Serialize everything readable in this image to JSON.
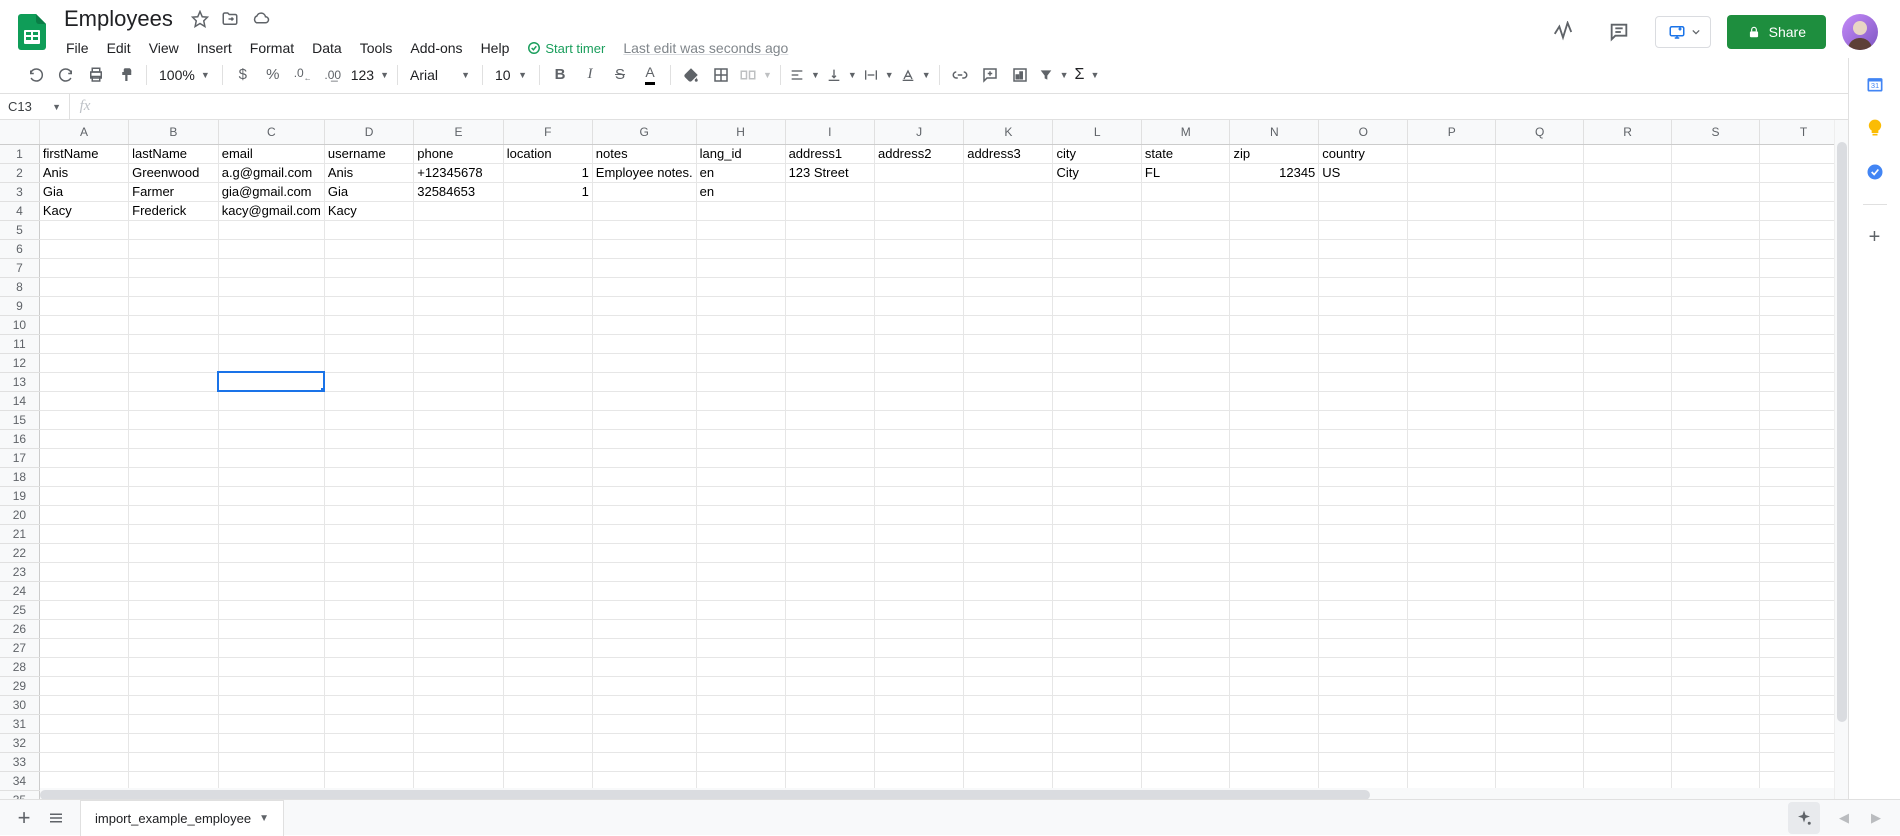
{
  "doc_title": "Employees",
  "menus": [
    "File",
    "Edit",
    "View",
    "Insert",
    "Format",
    "Data",
    "Tools",
    "Add-ons",
    "Help"
  ],
  "start_timer": "Start timer",
  "last_edit": "Last edit was seconds ago",
  "share": "Share",
  "toolbar": {
    "zoom": "100%",
    "currency": "$",
    "percent": "%",
    "dec_dec": ".0",
    "inc_dec": ".00",
    "format_more": "123",
    "font": "Arial",
    "font_size": "10"
  },
  "name_box": "C13",
  "fx": "fx",
  "columns": [
    "A",
    "B",
    "C",
    "D",
    "E",
    "F",
    "G",
    "H",
    "I",
    "J",
    "K",
    "L",
    "M",
    "N",
    "O",
    "P",
    "Q",
    "R",
    "S",
    "T"
  ],
  "row_count": 35,
  "selected_cell": {
    "row": 13,
    "col": 3
  },
  "chart_data": {
    "type": "table",
    "headers": [
      "firstName",
      "lastName",
      "email",
      "username",
      "phone",
      "location",
      "notes",
      "lang_id",
      "address1",
      "address2",
      "address3",
      "city",
      "state",
      "zip",
      "country"
    ],
    "rows": [
      {
        "firstName": "Anis",
        "lastName": "Greenwood",
        "email": "a.g@gmail.com",
        "username": "Anis",
        "phone": "+12345678",
        "location": "1",
        "notes": "Employee notes.",
        "lang_id": "en",
        "address1": "123 Street",
        "address2": "",
        "address3": "",
        "city": "City",
        "state": "FL",
        "zip": "12345",
        "country": "US"
      },
      {
        "firstName": "Gia",
        "lastName": "Farmer",
        "email": "gia@gmail.com",
        "username": "Gia",
        "phone": "32584653",
        "location": "1",
        "notes": "",
        "lang_id": "en",
        "address1": "",
        "address2": "",
        "address3": "",
        "city": "",
        "state": "",
        "zip": "",
        "country": ""
      },
      {
        "firstName": "Kacy",
        "lastName": "Frederick",
        "email": "kacy@gmail.com",
        "username": "Kacy",
        "phone": "",
        "location": "",
        "notes": "",
        "lang_id": "",
        "address1": "",
        "address2": "",
        "address3": "",
        "city": "",
        "state": "",
        "zip": "",
        "country": ""
      }
    ]
  },
  "sheet_tab": "import_example_employee"
}
